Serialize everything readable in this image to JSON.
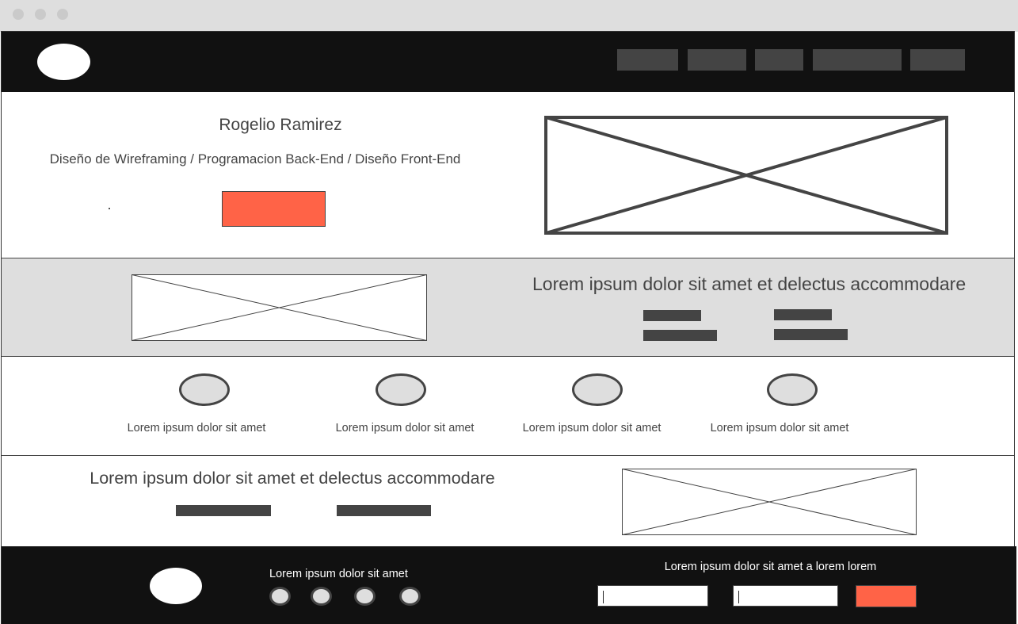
{
  "window": {
    "controls": [
      "close-dot",
      "minimize-dot",
      "zoom-dot"
    ]
  },
  "header": {
    "logo_icon": "logo-oval-icon",
    "nav_items": [
      "",
      "",
      "",
      "",
      ""
    ]
  },
  "hero": {
    "name": "Rogelio Ramirez",
    "subtitle": "Diseño de Wireframing / Programacion Back-End / Diseño Front-End",
    "cta_color": "#ff6347",
    "image_icon": "image-placeholder-icon"
  },
  "band": {
    "title": "Lorem ipsum dolor sit amet et delectus accommodare",
    "image_icon": "image-placeholder-icon"
  },
  "features": {
    "items": [
      {
        "label": "Lorem ipsum dolor sit amet",
        "icon": "circle-icon"
      },
      {
        "label": "Lorem ipsum dolor sit amet",
        "icon": "circle-icon"
      },
      {
        "label": "Lorem ipsum dolor sit amet",
        "icon": "circle-icon"
      },
      {
        "label": "Lorem ipsum dolor sit amet",
        "icon": "circle-icon"
      }
    ]
  },
  "lower": {
    "title": "Lorem ipsum dolor sit amet et delectus accommodare",
    "image_icon": "image-placeholder-icon"
  },
  "footer": {
    "logo_icon": "logo-oval-icon",
    "tagline": "Lorem ipsum dolor sit amet",
    "social_icons": [
      "social-icon",
      "social-icon",
      "social-icon",
      "social-icon"
    ],
    "form_heading": "Lorem ipsum dolor sit amet a lorem lorem",
    "submit_color": "#ff6347"
  },
  "colors": {
    "dark": "#111111",
    "gray": "#dedede",
    "accent": "#ff6347",
    "ink": "#444444"
  }
}
